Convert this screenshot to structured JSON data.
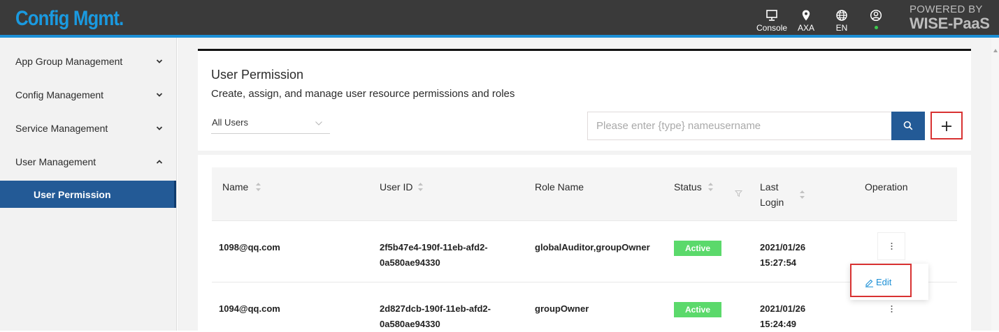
{
  "app": {
    "title": "Config Mgmt."
  },
  "topbar": {
    "console_label": "Console",
    "location_label": "AXA",
    "language_label": "EN",
    "powered_line1": "POWERED BY",
    "powered_line2": "WISE-PaaS"
  },
  "sidebar": {
    "items": [
      {
        "label": "App Group Management",
        "expanded": false
      },
      {
        "label": "Config Management",
        "expanded": false
      },
      {
        "label": "Service Management",
        "expanded": false
      },
      {
        "label": "User Management",
        "expanded": true
      }
    ],
    "sub_items": [
      {
        "label": "User Permission",
        "active": true
      }
    ]
  },
  "page": {
    "title": "User Permission",
    "subtitle": "Create, assign, and manage user resource permissions and roles"
  },
  "filter": {
    "selected": "All Users"
  },
  "search": {
    "placeholder": "Please enter {type} nameusername",
    "value": ""
  },
  "table": {
    "columns": {
      "name": "Name",
      "user_id": "User ID",
      "role_name": "Role Name",
      "status": "Status",
      "last_login_1": "Last",
      "last_login_2": "Login",
      "operation": "Operation"
    },
    "rows": [
      {
        "name": "1098@qq.com",
        "user_id_1": "2f5b47e4-190f-11eb-afd2-",
        "user_id_2": "0a580ae94330",
        "role_name": "globalAuditor,groupOwner",
        "status": "Active",
        "last_login_date": "2021/01/26",
        "last_login_time": "15:27:54"
      },
      {
        "name": "1094@qq.com",
        "user_id_1": "2d827dcb-190f-11eb-afd2-",
        "user_id_2": "0a580ae94330",
        "role_name": "groupOwner",
        "status": "Active",
        "last_login_date": "2021/01/26",
        "last_login_time": "15:24:49"
      }
    ]
  },
  "operation_menu": {
    "edit_label": "Edit"
  },
  "colors": {
    "brand": "#1a9ae0",
    "topbar": "#3a3a3a",
    "primary": "#235a96",
    "active_badge": "#5bd96b",
    "highlight_box": "#d83232",
    "link": "#1b8fd6"
  }
}
